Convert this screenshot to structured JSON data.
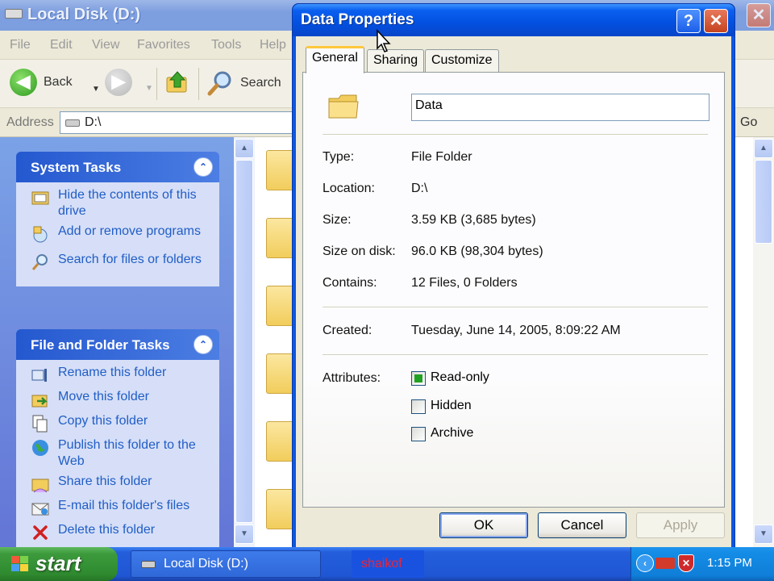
{
  "explorer": {
    "title": "Local Disk (D:)",
    "close_glyph": "✕",
    "menu": [
      "File",
      "Edit",
      "View",
      "Favorites",
      "Tools",
      "Help"
    ],
    "toolbar": {
      "back_label": "Back",
      "search_label": "Search",
      "dropdown_glyph": "▼"
    },
    "address": {
      "label": "Address",
      "value": "D:\\",
      "go_label": "Go"
    },
    "task_pane": {
      "system_tasks": {
        "title": "System Tasks",
        "collapse_glyph": "⌃",
        "items": [
          {
            "label": "Hide the contents of this drive",
            "icon": "hide-contents-icon"
          },
          {
            "label": "Add or remove programs",
            "icon": "add-remove-programs-icon"
          },
          {
            "label": "Search for files or folders",
            "icon": "search-icon"
          }
        ]
      },
      "file_folder_tasks": {
        "title": "File and Folder Tasks",
        "collapse_glyph": "⌃",
        "items": [
          {
            "label": "Rename this folder",
            "icon": "rename-icon"
          },
          {
            "label": "Move this folder",
            "icon": "move-icon"
          },
          {
            "label": "Copy this folder",
            "icon": "copy-icon"
          },
          {
            "label": "Publish this folder to the Web",
            "icon": "globe-icon"
          },
          {
            "label": "Share this folder",
            "icon": "share-icon"
          },
          {
            "label": "E-mail this folder's files",
            "icon": "email-icon"
          },
          {
            "label": "Delete this folder",
            "icon": "delete-icon"
          }
        ]
      }
    }
  },
  "dialog": {
    "title": "Data Properties",
    "help_glyph": "?",
    "close_glyph": "✕",
    "tabs": [
      "General",
      "Sharing",
      "Customize"
    ],
    "active_tab": "General",
    "name": "Data",
    "properties": {
      "type": {
        "label": "Type:",
        "value": "File Folder"
      },
      "location": {
        "label": "Location:",
        "value": "D:\\"
      },
      "size": {
        "label": "Size:",
        "value": "3.59 KB (3,685 bytes)"
      },
      "size_on_disk": {
        "label": "Size on disk:",
        "value": "96.0 KB (98,304 bytes)"
      },
      "contains": {
        "label": "Contains:",
        "value": "12 Files, 0 Folders"
      },
      "created": {
        "label": "Created:",
        "value": "Tuesday, June 14, 2005, 8:09:22 AM"
      }
    },
    "attributes": {
      "label": "Attributes:",
      "read_only": {
        "label": "Read-only",
        "checked": true
      },
      "hidden": {
        "label": "Hidden",
        "checked": false
      },
      "archive": {
        "label": "Archive",
        "checked": false
      }
    },
    "buttons": {
      "ok": "OK",
      "cancel": "Cancel",
      "apply": "Apply"
    }
  },
  "taskbar": {
    "start_label": "start",
    "window_button_label": "Local Disk (D:)",
    "user_label": "shaikof",
    "tray_expand_glyph": "‹",
    "shield_glyph": "✕",
    "clock": "1:15 PM"
  },
  "colors": {
    "dialog_title": "#0350e0",
    "task_link": "#215dc6",
    "taskbar": "#245edb",
    "start": "#3c9a3c",
    "tab_highlight": "#ffc83d"
  }
}
